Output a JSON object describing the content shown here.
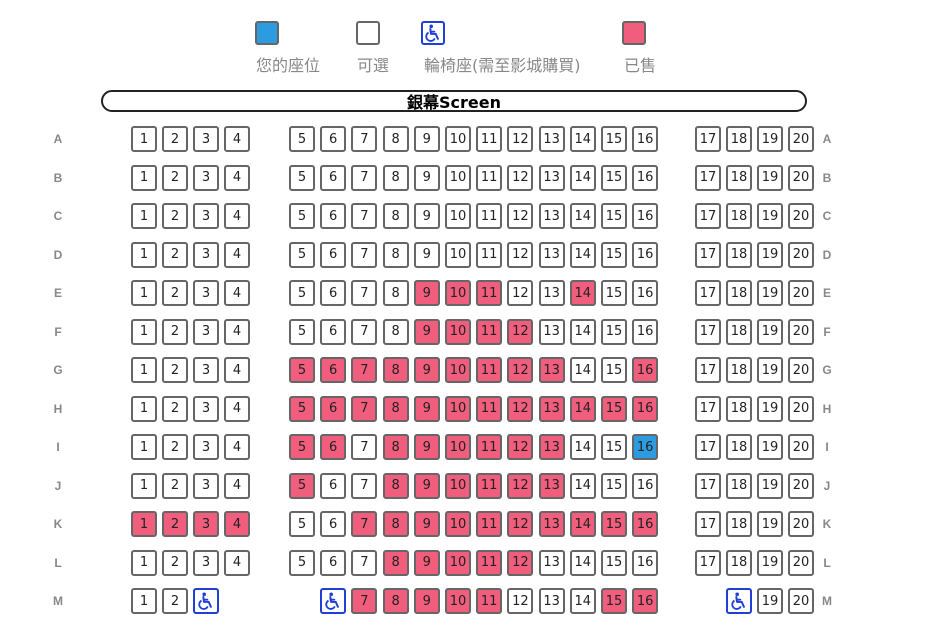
{
  "legend": {
    "mine_label": "您的座位",
    "available_label": "可選",
    "wheelchair_label": "輪椅座(需至影城購買)",
    "sold_label": "已售",
    "colors": {
      "mine": "#2d9be0",
      "available": "#ffffff",
      "sold": "#f05d7d",
      "wheelchair": "#1f3fd8"
    }
  },
  "screen_label": "銀幕Screen",
  "rows": [
    {
      "label": "A",
      "sold": [],
      "mine": [],
      "wheelchair": []
    },
    {
      "label": "B",
      "sold": [],
      "mine": [],
      "wheelchair": []
    },
    {
      "label": "C",
      "sold": [],
      "mine": [],
      "wheelchair": []
    },
    {
      "label": "D",
      "sold": [],
      "mine": [],
      "wheelchair": []
    },
    {
      "label": "E",
      "sold": [
        9,
        10,
        11,
        14
      ],
      "mine": [],
      "wheelchair": []
    },
    {
      "label": "F",
      "sold": [
        9,
        10,
        11,
        12
      ],
      "mine": [],
      "wheelchair": []
    },
    {
      "label": "G",
      "sold": [
        5,
        6,
        7,
        8,
        9,
        10,
        11,
        12,
        13,
        16
      ],
      "mine": [],
      "wheelchair": []
    },
    {
      "label": "H",
      "sold": [
        5,
        6,
        7,
        8,
        9,
        10,
        11,
        12,
        13,
        14,
        15,
        16
      ],
      "mine": [],
      "wheelchair": []
    },
    {
      "label": "I",
      "sold": [
        5,
        6,
        8,
        9,
        10,
        11,
        12,
        13
      ],
      "mine": [
        16
      ],
      "wheelchair": []
    },
    {
      "label": "J",
      "sold": [
        5,
        8,
        9,
        10,
        11,
        12,
        13
      ],
      "mine": [],
      "wheelchair": []
    },
    {
      "label": "K",
      "sold": [
        1,
        2,
        3,
        4,
        7,
        8,
        9,
        10,
        11,
        12,
        13,
        14,
        15,
        16
      ],
      "mine": [],
      "wheelchair": []
    },
    {
      "label": "L",
      "sold": [
        8,
        9,
        10,
        11,
        12
      ],
      "mine": [],
      "wheelchair": []
    },
    {
      "label": "M",
      "sold": [
        7,
        8,
        9,
        10,
        11,
        15,
        16
      ],
      "mine": [],
      "wheelchair": [
        3,
        6,
        18
      ],
      "missing": [
        4,
        5,
        17
      ]
    }
  ]
}
